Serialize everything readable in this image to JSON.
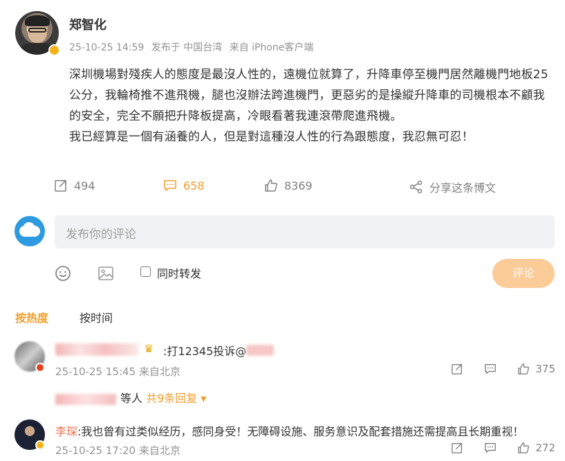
{
  "post": {
    "username": "郑智化",
    "timestamp": "25-10-25 14:59",
    "published_in": "发布于 中国台湾",
    "source": "来自 iPhone客户端",
    "paragraphs": [
      "深圳機場對殘疾人的態度是最沒人性的，遠機位就算了，升降車停至機門居然離機門地板25公分，我輪椅推不進飛機，腿也沒辦法跨進機門，更惡劣的是操縱升降車的司機根本不顧我的安全，完全不願把升降板提高，冷眼看著我連滾帶爬進飛機。",
      "我已經算是一個有涵養的人，但是對這種沒人性的行為跟態度，我忍無可忍！"
    ],
    "repost_count": "494",
    "comment_count": "658",
    "like_count": "8369",
    "share_label": "分享这条博文",
    "accent_color": "#f09d2c"
  },
  "comment_box": {
    "placeholder": "发布你的评论",
    "repost_label": "同时转发",
    "submit_label": "评论"
  },
  "sort": {
    "hot": "按热度",
    "time": "按时间"
  },
  "comments": [
    {
      "text": ":打12345投诉@",
      "time": "25-10-25 15:45 来自北京",
      "likes": "375",
      "sub_suffix": "等人",
      "sub_more": "共9条回复 ▾"
    },
    {
      "name": "李琛",
      "text": ":我也曾有过类似经历，感同身受！无障碍设施、服务意识及配套措施还需提高且长期重视！",
      "time": "25-10-25 17:20 来自北京",
      "likes": "272"
    }
  ]
}
